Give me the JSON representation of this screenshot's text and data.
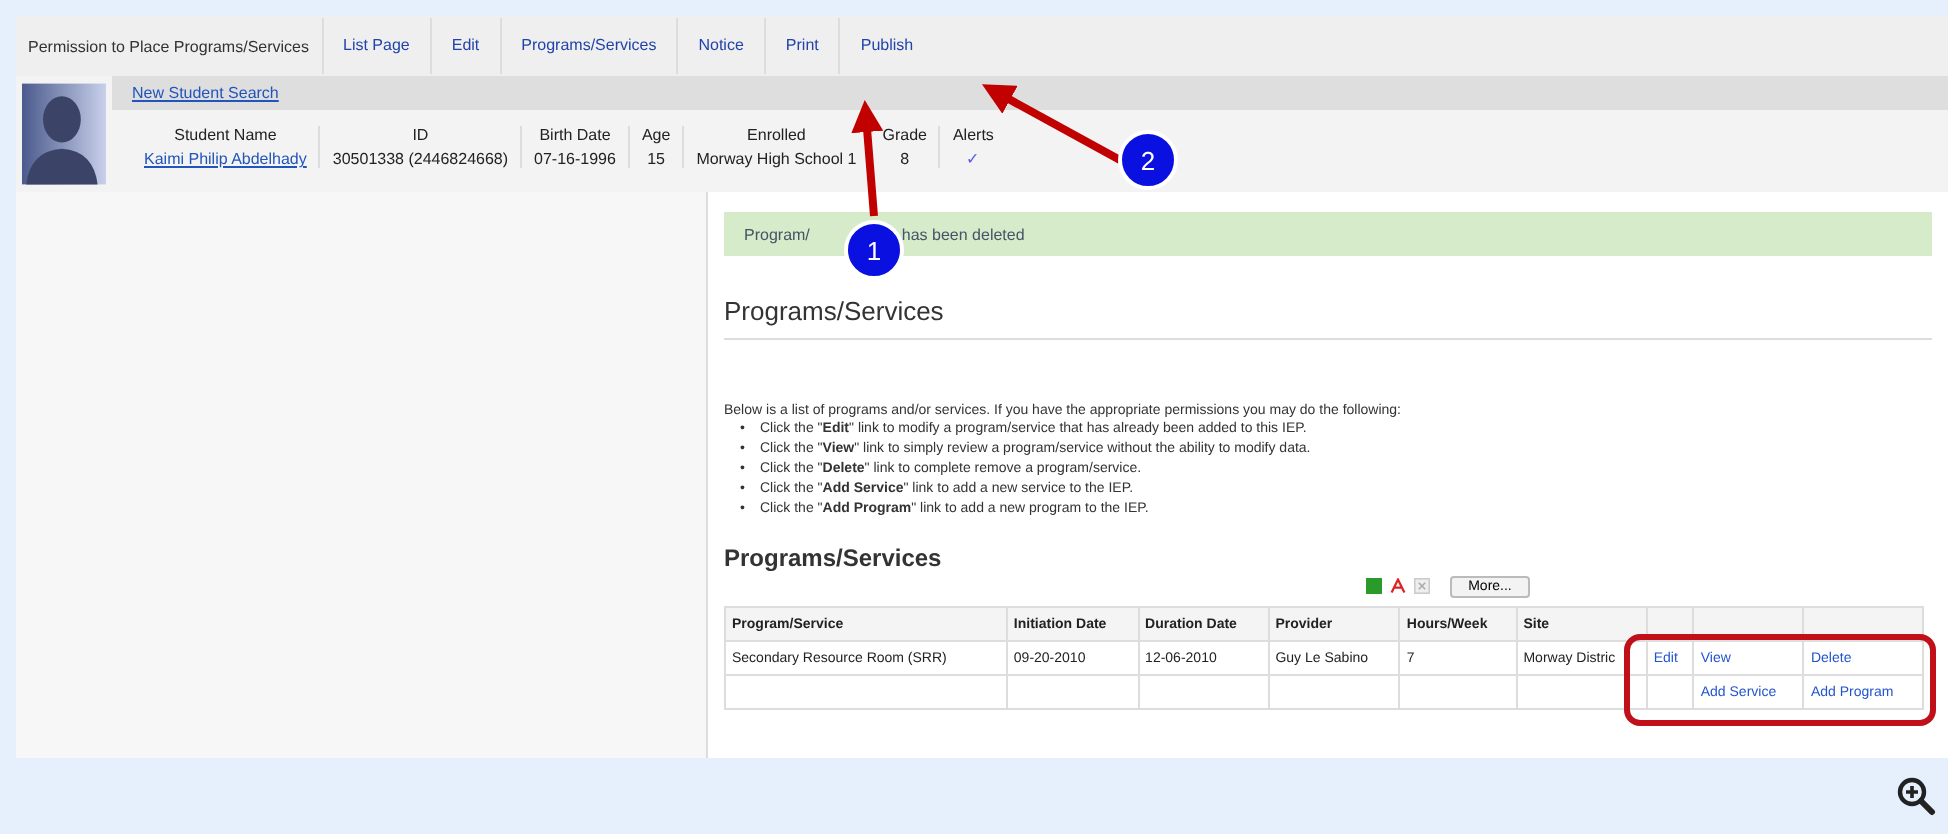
{
  "nav": {
    "title": "Permission to Place Programs/Services",
    "links": [
      "List Page",
      "Edit",
      "Programs/Services",
      "Notice",
      "Print",
      "Publish"
    ]
  },
  "student": {
    "search_link": "New Student Search",
    "fields": [
      {
        "label": "Student Name",
        "value": "Kaimi Philip Abdelhady",
        "kind": "link"
      },
      {
        "label": "ID",
        "value": "30501338 (2446824668)",
        "kind": "text"
      },
      {
        "label": "Birth Date",
        "value": "07-16-1996",
        "kind": "text"
      },
      {
        "label": "Age",
        "value": "15",
        "kind": "text"
      },
      {
        "label": "Enrolled",
        "value": "Morway High School 1",
        "kind": "text"
      },
      {
        "label": "Grade",
        "value": "8",
        "kind": "text"
      },
      {
        "label": "Alerts",
        "value": "✓",
        "kind": "alert"
      }
    ]
  },
  "message": {
    "parts": [
      "Program/",
      "has been deleted"
    ]
  },
  "heading": "Programs/Services",
  "intro": "Below is a list of programs and/or services. If you have the appropriate permissions you may do the following:",
  "bullets": [
    {
      "marker": "•",
      "text": "Click the \"**Edit**\" link to modify a program/service that has already been added to this IEP."
    },
    {
      "marker": "•",
      "text": "Click the \"**View**\" link to simply review a program/service without the ability to modify data."
    },
    {
      "marker": "•",
      "text": "Click the \"**Delete**\" link to complete remove a program/service."
    },
    {
      "marker": "•",
      "text": "Click the \"**Add Service**\" link to add a new service to the IEP."
    },
    {
      "marker": "•",
      "text": "Click the \"**Add Program**\" link to add a new program to the IEP."
    }
  ],
  "table": {
    "title": "Programs/Services",
    "more_button": "More...",
    "columns": [
      "Program/Service",
      "Initiation Date",
      "Duration Date",
      "Provider",
      "Hours/Week",
      "Site"
    ],
    "rows": [
      {
        "cells": [
          {
            "kind": "text",
            "text": "Secondary Resource Room (SRR)"
          },
          {
            "kind": "text",
            "text": "09-20-2010"
          },
          {
            "kind": "text",
            "text": "12-06-2010"
          },
          {
            "kind": "text",
            "text": "Guy Le Sabino"
          },
          {
            "kind": "text",
            "text": "7"
          },
          {
            "kind": "text",
            "text": "Morway Distric"
          },
          {
            "kind": "link",
            "text": "Edit"
          },
          {
            "kind": "link",
            "text": "View"
          },
          {
            "kind": "link",
            "text": "Delete"
          }
        ]
      },
      {
        "cells": [
          {
            "kind": "empty"
          },
          {
            "kind": "empty"
          },
          {
            "kind": "empty"
          },
          {
            "kind": "empty"
          },
          {
            "kind": "empty"
          },
          {
            "kind": "empty"
          },
          {
            "kind": "empty"
          },
          {
            "kind": "link",
            "text": "Add Service"
          },
          {
            "kind": "link",
            "text": "Add Program"
          }
        ]
      }
    ]
  },
  "callouts": [
    {
      "number": "1"
    },
    {
      "number": "2"
    }
  ]
}
